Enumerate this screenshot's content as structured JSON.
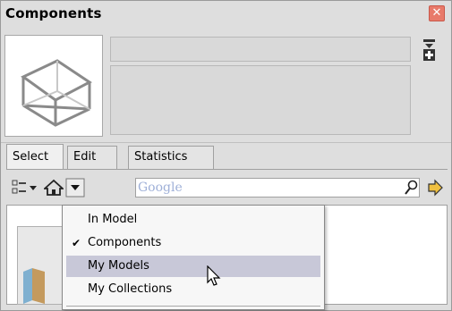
{
  "window": {
    "title": "Components"
  },
  "tabs": [
    {
      "label": "Select",
      "active": true
    },
    {
      "label": "Edit",
      "active": false
    },
    {
      "label": "Statistics",
      "active": false
    }
  ],
  "search": {
    "placeholder": "Google",
    "value": ""
  },
  "menu": {
    "items": [
      {
        "label": "In Model",
        "checked": false,
        "highlighted": false
      },
      {
        "label": "Components",
        "checked": true,
        "highlighted": false
      },
      {
        "label": "My Models",
        "checked": false,
        "highlighted": true
      },
      {
        "label": "My Collections",
        "checked": false,
        "highlighted": false
      }
    ]
  },
  "colors": {
    "highlight": "#c8c8d8",
    "close": "#e87a6a",
    "panel": "#dedede"
  },
  "icons": [
    "close-icon",
    "details-icon",
    "view-options-icon",
    "home-icon",
    "dropdown-arrow-icon",
    "search-icon",
    "forward-icon",
    "cursor-icon"
  ]
}
